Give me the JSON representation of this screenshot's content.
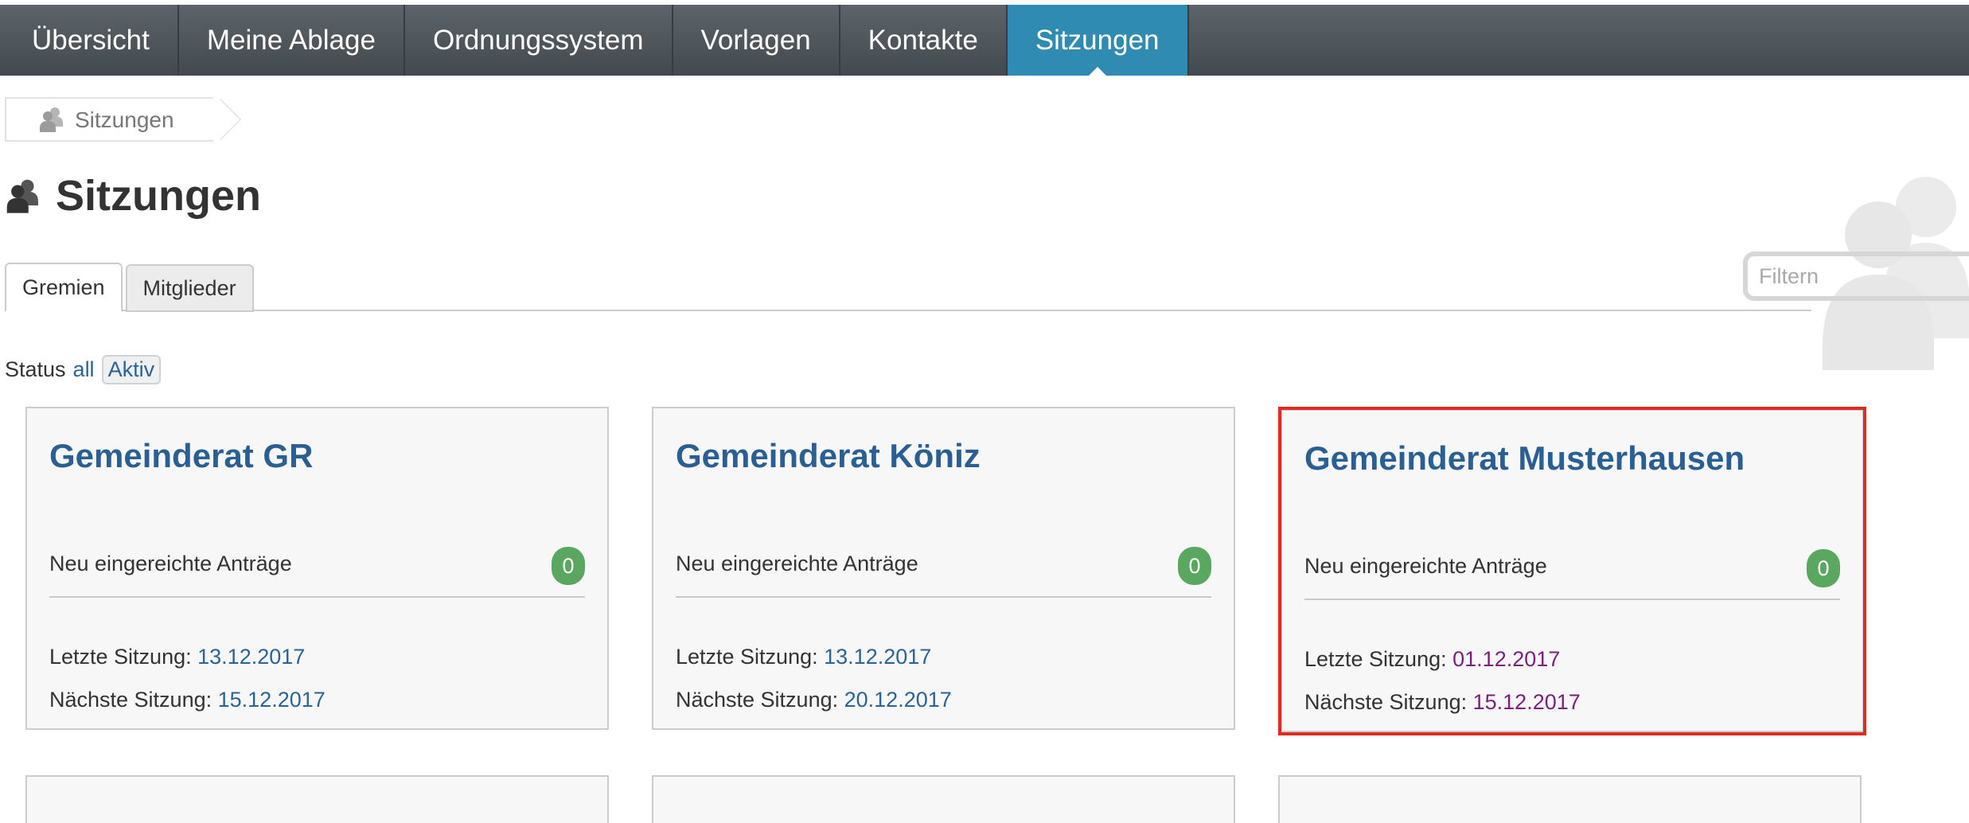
{
  "nav": {
    "items": [
      {
        "label": "Übersicht"
      },
      {
        "label": "Meine Ablage"
      },
      {
        "label": "Ordnungssystem"
      },
      {
        "label": "Vorlagen"
      },
      {
        "label": "Kontakte"
      },
      {
        "label": "Sitzungen"
      }
    ],
    "active": "Sitzungen"
  },
  "breadcrumb": {
    "label": "Sitzungen",
    "icon": "people-icon"
  },
  "page": {
    "title": "Sitzungen",
    "icon": "people-icon"
  },
  "filter": {
    "placeholder": "Filtern"
  },
  "tabs": [
    {
      "label": "Gremien",
      "active": true
    },
    {
      "label": "Mitglieder",
      "active": false
    }
  ],
  "status": {
    "label": "Status",
    "all": "all",
    "aktiv": "Aktiv"
  },
  "cards": [
    {
      "title": "Gemeinderat GR",
      "new_label": "Neu eingereichte Anträge",
      "new_count": "0",
      "last_label": "Letzte Sitzung:",
      "last_date": "13.12.2017",
      "next_label": "Nächste Sitzung:",
      "next_date": "15.12.2017"
    },
    {
      "title": "Gemeinderat Köniz",
      "new_label": "Neu eingereichte Anträge",
      "new_count": "0",
      "last_label": "Letzte Sitzung:",
      "last_date": "13.12.2017",
      "next_label": "Nächste Sitzung:",
      "next_date": "20.12.2017"
    },
    {
      "title": "Gemeinderat Musterhausen",
      "new_label": "Neu eingereichte Anträge",
      "new_count": "0",
      "last_label": "Letzte Sitzung:",
      "last_date": "01.12.2017",
      "next_label": "Nächste Sitzung:",
      "next_date": "15.12.2017",
      "highlighted": true
    }
  ],
  "colors": {
    "nav_active": "#2f8bb1",
    "link": "#2a6496",
    "card_title": "#2a5f94",
    "badge": "#5aa860",
    "highlight_border": "#e02b20",
    "visited_date": "#7a1f7e"
  }
}
